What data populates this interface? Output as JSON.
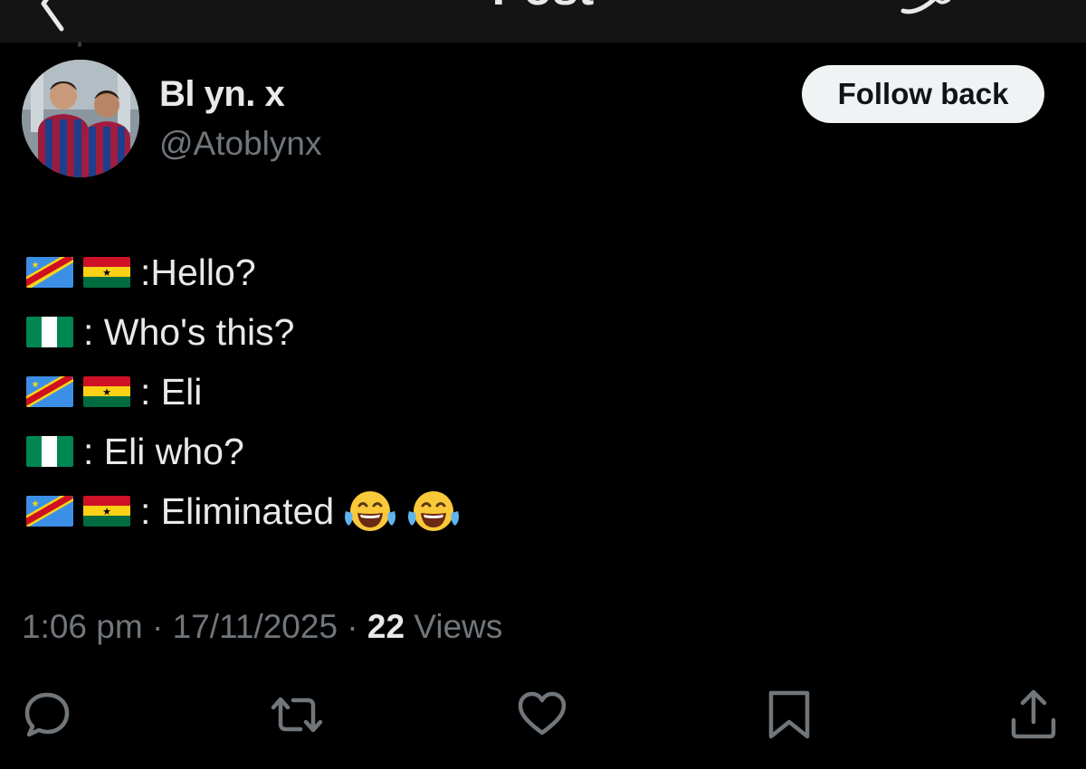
{
  "header": {
    "title": "Post"
  },
  "profile": {
    "display_name": "Bl yn. x",
    "handle": "@Atoblynx",
    "follow_label": "Follow back"
  },
  "post": {
    "lines": [
      {
        "flags": [
          "dr-congo",
          "ghana"
        ],
        "text": ":Hello?"
      },
      {
        "flags": [
          "nigeria"
        ],
        "text": ": Who's this?"
      },
      {
        "flags": [
          "dr-congo",
          "ghana"
        ],
        "text": ": Eli"
      },
      {
        "flags": [
          "nigeria"
        ],
        "text": ": Eli who?"
      },
      {
        "flags": [
          "dr-congo",
          "ghana"
        ],
        "text": ": Eliminated",
        "emojis": [
          "face-with-tears-of-joy",
          "face-with-tears-of-joy"
        ]
      }
    ],
    "time": "1:06 pm",
    "date": "17/11/2025",
    "views_count": "22",
    "views_label": "Views"
  },
  "actions": [
    "reply-icon",
    "repost-icon",
    "like-icon",
    "bookmark-icon",
    "share-icon"
  ],
  "colors": {
    "background": "#000000",
    "text": "#e7e9ea",
    "muted": "#71767b",
    "button_bg": "#eff3f4"
  }
}
